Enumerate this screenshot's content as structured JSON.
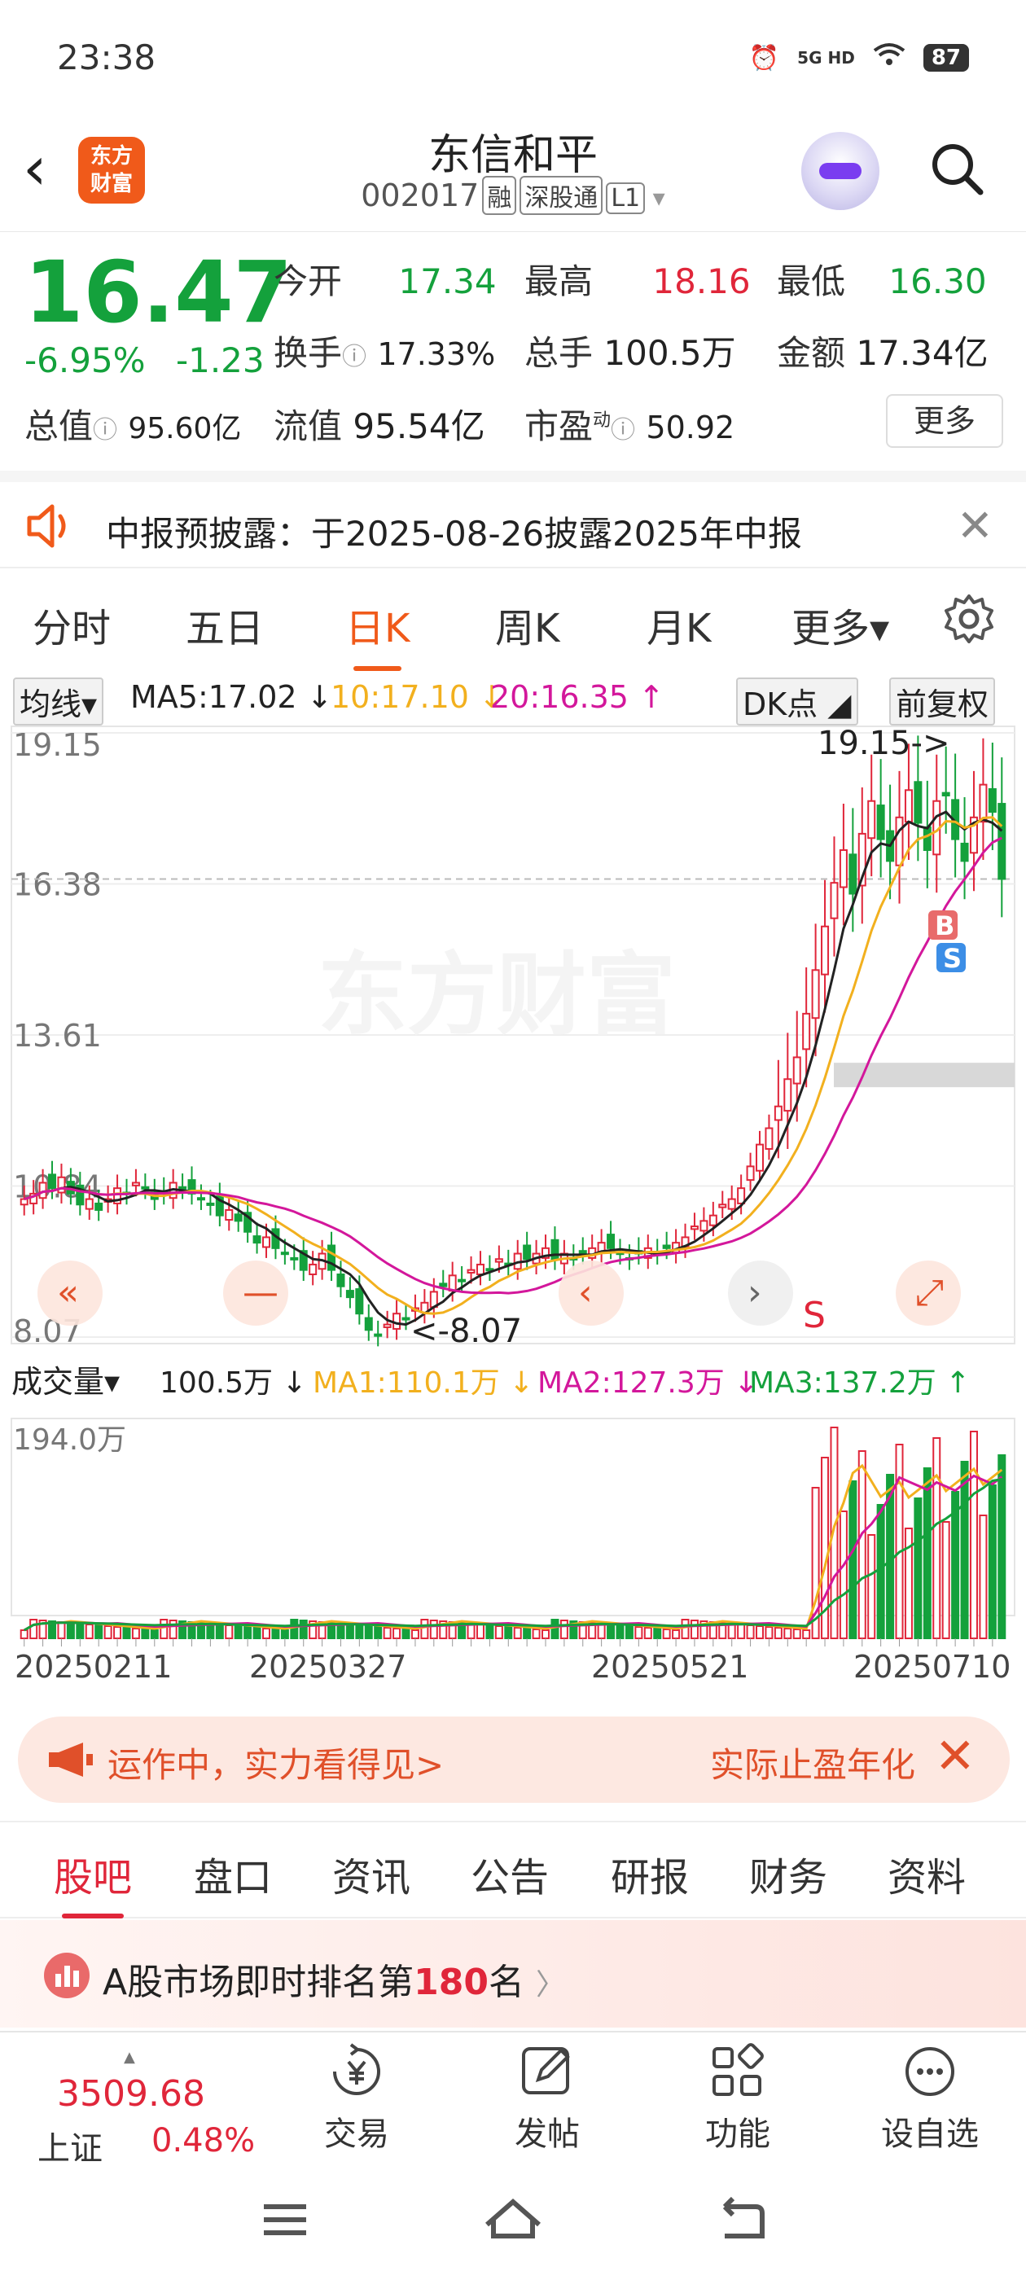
{
  "status_bar": {
    "time": "23:38",
    "network": "5G HD",
    "battery": "87"
  },
  "header": {
    "logo_text": "东方财富",
    "stock_name": "东信和平",
    "stock_code": "002017",
    "tags": [
      "融",
      "深股通",
      "L1"
    ]
  },
  "quote": {
    "price": "16.47",
    "change_pct": "-6.95%",
    "change_abs": "-1.23",
    "open_label": "今开",
    "open": "17.34",
    "high_label": "最高",
    "high": "18.16",
    "low_label": "最低",
    "low": "16.30",
    "turnover_label": "换手",
    "turnover": "17.33%",
    "volume_label": "总手",
    "volume": "100.5万",
    "amount_label": "金额",
    "amount": "17.34亿",
    "mktcap_label": "总值",
    "mktcap": "95.60亿",
    "float_label": "流值",
    "float_cap": "95.54亿",
    "pe_label": "市盈",
    "pe_sup": "动",
    "pe": "50.92",
    "more_label": "更多"
  },
  "notice": {
    "text": "中报预披露：于2025-08-26披露2025年中报"
  },
  "ktabs": [
    {
      "label": "分时"
    },
    {
      "label": "五日"
    },
    {
      "label": "日K"
    },
    {
      "label": "周K"
    },
    {
      "label": "月K"
    },
    {
      "label": "更多▾"
    }
  ],
  "indicator": {
    "selector": "均线▾",
    "ma5": "MA5:17.02 ↓",
    "ma10": "10:17.10 ↓",
    "ma20": "20:16.35 ↑",
    "dk": "DK点",
    "adj": "前复权",
    "colors": {
      "ma5": "#222222",
      "ma10": "#f2b01e",
      "ma20": "#d3179b",
      "up": "#e0263a",
      "down": "#14a13c"
    }
  },
  "chart_data": [
    {
      "type": "candlestick",
      "title": "",
      "y_ticks": [
        "19.15",
        "16.38",
        "13.61",
        "10.84",
        "8.07"
      ],
      "ylim": [
        8.07,
        19.15
      ],
      "current_price_line": 16.47,
      "annotations": {
        "high_marker": "19.15->",
        "low_marker": "<-8.07",
        "buy": "B",
        "sell": "S",
        "s_mark": "S"
      },
      "watermark": "东方财富",
      "close": [
        10.6,
        10.7,
        10.9,
        10.8,
        11.0,
        10.7,
        10.5,
        10.6,
        10.4,
        10.6,
        10.8,
        10.7,
        10.9,
        10.8,
        10.6,
        10.7,
        10.9,
        10.8,
        10.7,
        10.6,
        10.5,
        10.3,
        10.4,
        10.2,
        10.0,
        9.8,
        9.9,
        9.7,
        9.6,
        9.5,
        9.3,
        9.4,
        9.6,
        9.3,
        9.0,
        8.8,
        8.5,
        8.2,
        8.1,
        8.3,
        8.5,
        8.4,
        8.6,
        8.7,
        8.9,
        9.0,
        9.2,
        9.1,
        9.3,
        9.4,
        9.3,
        9.5,
        9.4,
        9.6,
        9.5,
        9.6,
        9.7,
        9.5,
        9.6,
        9.5,
        9.6,
        9.7,
        9.8,
        9.7,
        9.6,
        9.5,
        9.6,
        9.7,
        9.6,
        9.7,
        9.8,
        9.9,
        10.1,
        10.2,
        10.3,
        10.5,
        10.6,
        10.8,
        11.2,
        11.6,
        11.9,
        12.3,
        12.8,
        13.2,
        14.0,
        14.8,
        15.6,
        16.4,
        17.0,
        16.2,
        17.3,
        17.9,
        17.2,
        16.8,
        17.6,
        18.1,
        17.5,
        17.0,
        17.9,
        18.0,
        17.2,
        16.8,
        17.6,
        18.2,
        17.7,
        16.47
      ],
      "ma5_last": 17.02,
      "ma10_last": 17.1,
      "ma20_last": 16.35
    },
    {
      "type": "bar",
      "title": "成交量",
      "selector": "成交量▾",
      "last_volume": "100.5万 ↓",
      "ma1": "MA1:110.1万 ↓",
      "ma2": "MA2:127.3万 ↓",
      "ma3": "MA3:137.2万 ↑",
      "y_max_label": "194.0万",
      "x_ticks": [
        "20250211",
        "20250327",
        "20250521",
        "20250710"
      ],
      "colors": {
        "ma1": "#f2b01e",
        "ma2": "#d3179b",
        "ma3": "#14a13c"
      }
    }
  ],
  "banner": {
    "left_text": "运作中，实力看得见>",
    "right_text": "实际止盈年化"
  },
  "subtabs": [
    {
      "label": "股吧"
    },
    {
      "label": "盘口"
    },
    {
      "label": "资讯"
    },
    {
      "label": "公告"
    },
    {
      "label": "研报"
    },
    {
      "label": "财务"
    },
    {
      "label": "资料"
    }
  ],
  "rank": {
    "prefix": "A股市场即时排名第",
    "num": "180",
    "suffix": "名",
    "arrow": "〉"
  },
  "toolbar": {
    "index_value": "3509.68",
    "index_name": "上证",
    "index_pct": "0.48%",
    "items": [
      {
        "label": "交易"
      },
      {
        "label": "发帖"
      },
      {
        "label": "功能"
      },
      {
        "label": "设自选"
      }
    ]
  }
}
